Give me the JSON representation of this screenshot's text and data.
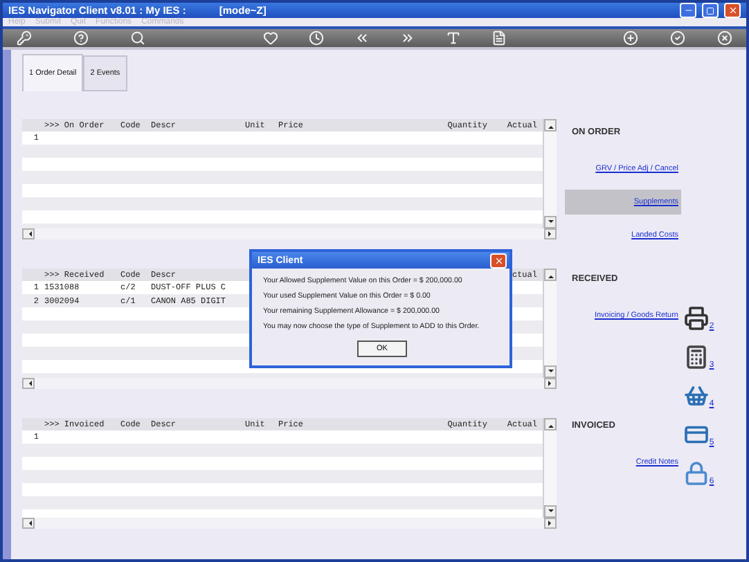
{
  "window": {
    "title": "IES Navigator Client v8.01 : My IES :",
    "mode": "[mode~Z]"
  },
  "menu": [
    {
      "label": "Help",
      "disabled": true
    },
    {
      "label": "Submit",
      "disabled": true
    },
    {
      "label": "Quit",
      "disabled": true
    },
    {
      "label": "Functions",
      "disabled": true
    },
    {
      "label": "Commands",
      "disabled": true
    }
  ],
  "tabs": [
    {
      "label": "1 Order Detail",
      "selected": true
    },
    {
      "label": "2 Events",
      "selected": false
    }
  ],
  "grids": [
    {
      "columns": [
        ">>> On Order",
        "Code",
        "Descr",
        "Unit",
        "Price",
        "Quantity",
        "Actual"
      ],
      "rows": [
        {
          "number": "1",
          "cells": []
        }
      ]
    },
    {
      "columns": [
        ">>> Received",
        "Code",
        "Descr",
        "",
        "",
        "",
        "ctual"
      ],
      "rows": [
        {
          "number": "1",
          "cells": [
            "1531088",
            "c/2",
            "DUST-OFF PLUS C"
          ]
        },
        {
          "number": "2",
          "cells": [
            "3002094",
            "c/1",
            "CANON A85 DIGIT"
          ]
        }
      ]
    },
    {
      "columns": [
        ">>> Invoiced",
        "Code",
        "Descr",
        "Unit",
        "Price",
        "Quantity",
        "Actual"
      ],
      "rows": [
        {
          "number": "1",
          "cells": []
        }
      ]
    }
  ],
  "sections": [
    {
      "heading": "ON ORDER",
      "links": [
        {
          "label": "GRV / Price Adj / Cancel",
          "selected": false
        },
        {
          "label": "Supplements",
          "selected": true
        },
        {
          "label": "Landed Costs",
          "selected": false
        }
      ]
    },
    {
      "heading": "RECEIVED",
      "links": [
        {
          "label": "Invoicing / Goods Return",
          "selected": false
        }
      ]
    },
    {
      "heading": "INVOICED",
      "links": [
        {
          "label": "Credit Notes",
          "selected": false
        }
      ]
    }
  ],
  "side_tools": [
    {
      "number": "2"
    },
    {
      "number": "3"
    },
    {
      "number": "4"
    },
    {
      "number": "5"
    },
    {
      "number": "6"
    }
  ],
  "dialog": {
    "title": "IES Client",
    "lines": [
      "Your Allowed Supplement Value on this Order = $ 200,000.00",
      "Your used Supplement Value on this Order = $ 0.00",
      "Your remaining Supplement Allowance = $ 200,000.00",
      "You may now choose the type of Supplement to ADD to this Order."
    ],
    "button": "OK"
  }
}
